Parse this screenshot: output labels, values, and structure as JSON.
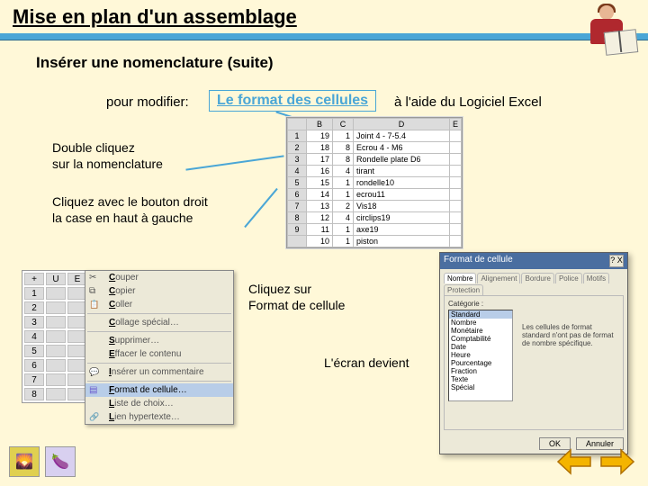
{
  "title": "Mise en plan d'un assemblage",
  "subtitle": "Insérer une nomenclature (suite)",
  "labels": {
    "modify": "pour modifier:",
    "format_link": "Le format des cellules",
    "excel_help": "à l'aide du Logiciel Excel",
    "dbl_click": "Double cliquez\nsur la nomenclature",
    "right_click": "Cliquez avec le bouton droit\nla case en haut à gauche",
    "click_format": "Cliquez sur\nFormat de cellule",
    "screen_becomes": "L'écran devient"
  },
  "excel": {
    "cols": [
      "",
      "B",
      "C",
      "D",
      "E"
    ],
    "rows": [
      {
        "r": "1",
        "b": "19",
        "c": "1",
        "d": "Joint 4 - 7-5.4"
      },
      {
        "r": "2",
        "b": "18",
        "c": "8",
        "d": "Ecrou  4 - M6"
      },
      {
        "r": "3",
        "b": "17",
        "c": "8",
        "d": "Rondelle plate D6"
      },
      {
        "r": "4",
        "b": "16",
        "c": "4",
        "d": "tirant"
      },
      {
        "r": "5",
        "b": "15",
        "c": "1",
        "d": "rondelle10"
      },
      {
        "r": "6",
        "b": "14",
        "c": "1",
        "d": "ecrou11"
      },
      {
        "r": "7",
        "b": "13",
        "c": "2",
        "d": "Vis18"
      },
      {
        "r": "8",
        "b": "12",
        "c": "4",
        "d": "circlips19"
      },
      {
        "r": "9",
        "b": "11",
        "c": "1",
        "d": "axe19"
      },
      {
        "r": "",
        "b": "10",
        "c": "1",
        "d": "piston"
      }
    ]
  },
  "rowheaders": {
    "corner": "",
    "cols": [
      "U",
      "E"
    ],
    "rows": [
      "1",
      "2",
      "3",
      "4",
      "5",
      "6",
      "7",
      "8"
    ]
  },
  "menu": [
    {
      "icon": "cut",
      "u": "C",
      "rest": "ouper"
    },
    {
      "icon": "copy",
      "u": "C",
      "rest": "opier"
    },
    {
      "icon": "paste",
      "u": "C",
      "rest": "oller"
    },
    {
      "sep": true
    },
    {
      "u": "C",
      "rest": "ollage spécial…"
    },
    {
      "sep": true
    },
    {
      "u": "S",
      "rest": "upprimer…"
    },
    {
      "u": "E",
      "rest": "ffacer le contenu"
    },
    {
      "sep": true
    },
    {
      "icon": "comment",
      "u": "I",
      "rest": "nsérer un commentaire"
    },
    {
      "sep": true
    },
    {
      "icon": "chart",
      "u": "F",
      "rest": "ormat de cellule…",
      "hl": true
    },
    {
      "u": "L",
      "rest": "iste de choix…"
    },
    {
      "icon": "link",
      "u": "L",
      "rest": "ien hypertexte…"
    }
  ],
  "dialog": {
    "title": "Format de cellule",
    "close": "?  X",
    "tabs": [
      "Alignement",
      "Bordure",
      "Police",
      "Motifs",
      "Protection"
    ],
    "active_tab": "Nombre",
    "category_label": "Catégorie :",
    "categories": [
      "Standard",
      "Nombre",
      "Monétaire",
      "Comptabilité",
      "Date",
      "Heure",
      "Pourcentage",
      "Fraction",
      "Texte",
      "Spécial"
    ],
    "selected": "Standard",
    "desc": "Les cellules de format standard n'ont pas de format de nombre spécifique.",
    "ok": "OK",
    "cancel": "Annuler"
  }
}
